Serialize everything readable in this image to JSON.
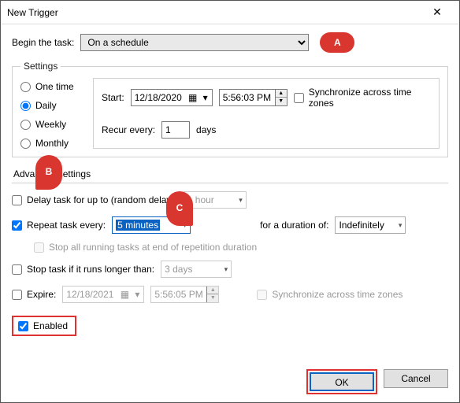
{
  "window": {
    "title": "New Trigger"
  },
  "begin": {
    "label": "Begin the task:",
    "value": "On a schedule"
  },
  "callouts": {
    "a": "A",
    "b": "B",
    "c": "C"
  },
  "settings": {
    "legend": "Settings",
    "radios": {
      "one": "One time",
      "daily": "Daily",
      "weekly": "Weekly",
      "monthly": "Monthly"
    },
    "start_label": "Start:",
    "start_date": "12/18/2020",
    "start_time": "5:56:03 PM",
    "sync_tz": "Synchronize across time zones",
    "recur_label": "Recur every:",
    "recur_value": "1",
    "recur_unit": "days"
  },
  "adv": {
    "title": "Advanced settings",
    "delay_label": "Delay task for up to (random delay):",
    "delay_value": "1 hour",
    "repeat_label": "Repeat task every:",
    "repeat_value": "5 minutes",
    "duration_label": "for a duration of:",
    "duration_value": "Indefinitely",
    "stop_all": "Stop all running tasks at end of repetition duration",
    "stop_if_label": "Stop task if it runs longer than:",
    "stop_if_value": "3 days",
    "expire_label": "Expire:",
    "expire_date": "12/18/2021",
    "expire_time": "5:56:05 PM",
    "sync_tz2": "Synchronize across time zones",
    "enabled": "Enabled"
  },
  "footer": {
    "ok": "OK",
    "cancel": "Cancel"
  }
}
